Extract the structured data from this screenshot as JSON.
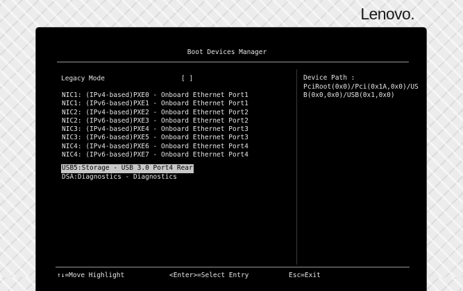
{
  "brand": {
    "logo_text": "Lenovo."
  },
  "screen": {
    "title": "Boot Devices Manager",
    "legacy_mode": {
      "label": "Legacy Mode",
      "value": "[ ]"
    },
    "devices": [
      {
        "label": "NIC1: (IPv4-based)PXE0 - Onboard Ethernet Port1",
        "selected": false
      },
      {
        "label": "NIC1: (IPv6-based)PXE1 - Onboard Ethernet Port1",
        "selected": false
      },
      {
        "label": "NIC2: (IPv4-based)PXE2 - Onboard Ethernet Port2",
        "selected": false
      },
      {
        "label": "NIC2: (IPv6-based)PXE3 - Onboard Ethernet Port2",
        "selected": false
      },
      {
        "label": "NIC3: (IPv4-based)PXE4 - Onboard Ethernet Port3",
        "selected": false
      },
      {
        "label": "NIC3: (IPv6-based)PXE5 - Onboard Ethernet Port3",
        "selected": false
      },
      {
        "label": "NIC4: (IPv4-based)PXE6 - Onboard Ethernet Port4",
        "selected": false
      },
      {
        "label": "NIC4: (IPv6-based)PXE7 - Onboard Ethernet Port4",
        "selected": false
      },
      {
        "label": "USB5:Storage - USB 3.0 Port4 Rear",
        "selected": true
      },
      {
        "label": "DSA:Diagnostics - Diagnostics",
        "selected": false
      }
    ],
    "help": {
      "heading": "Device Path :",
      "line1": "PciRoot(0x0)/Pci(0x1A,0x0)/US",
      "line2": "B(0x0,0x0)/USB(0x1,0x0)"
    },
    "key_hints": {
      "move": "↑↓=Move Highlight",
      "select": "<Enter>=Select Entry",
      "exit": "Esc=Exit"
    }
  }
}
